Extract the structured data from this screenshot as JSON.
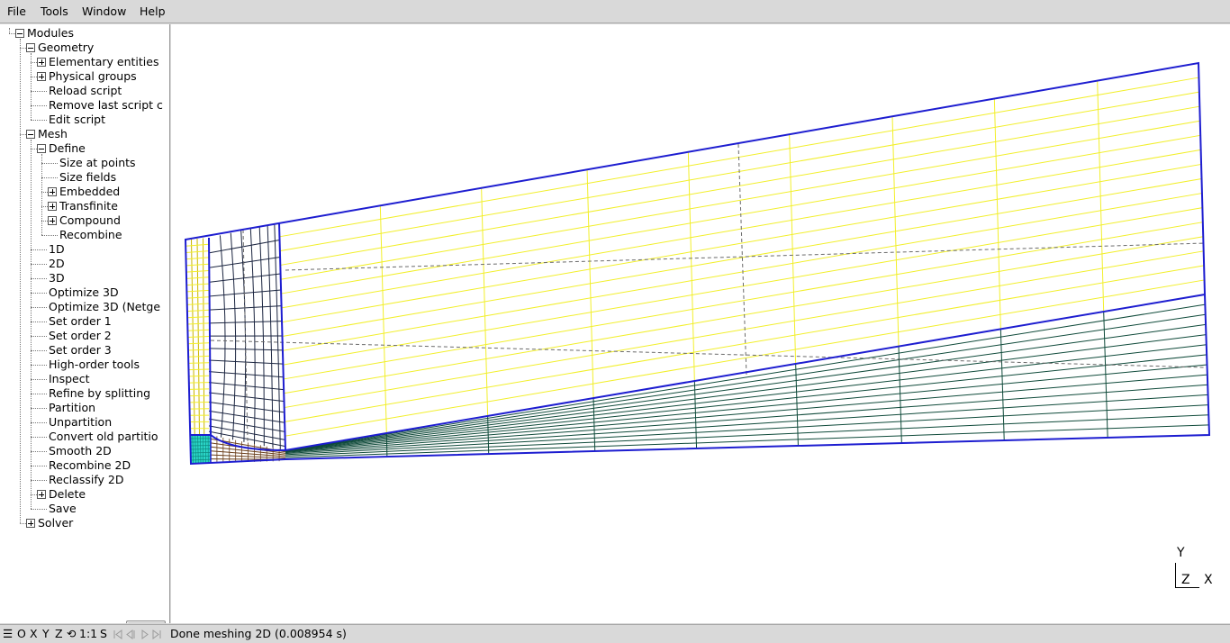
{
  "menu": {
    "file": "File",
    "tools": "Tools",
    "window": "Window",
    "help": "Help"
  },
  "tree": [
    {
      "label": "Modules",
      "toggle": "minus"
    },
    {
      "label": "Geometry",
      "toggle": "minus"
    },
    {
      "label": "Elementary entities",
      "toggle": "plus"
    },
    {
      "label": "Physical groups",
      "toggle": "plus"
    },
    {
      "label": "Reload script",
      "toggle": "none"
    },
    {
      "label": "Remove last script c",
      "toggle": "none"
    },
    {
      "label": "Edit script",
      "toggle": "none"
    },
    {
      "label": "Mesh",
      "toggle": "minus"
    },
    {
      "label": "Define",
      "toggle": "minus"
    },
    {
      "label": "Size at points",
      "toggle": "none"
    },
    {
      "label": "Size fields",
      "toggle": "none"
    },
    {
      "label": "Embedded",
      "toggle": "plus"
    },
    {
      "label": "Transfinite",
      "toggle": "plus"
    },
    {
      "label": "Compound",
      "toggle": "plus"
    },
    {
      "label": "Recombine",
      "toggle": "none"
    },
    {
      "label": "1D",
      "toggle": "none"
    },
    {
      "label": "2D",
      "toggle": "none"
    },
    {
      "label": "3D",
      "toggle": "none"
    },
    {
      "label": "Optimize 3D",
      "toggle": "none"
    },
    {
      "label": "Optimize 3D (Netge",
      "toggle": "none"
    },
    {
      "label": "Set order 1",
      "toggle": "none"
    },
    {
      "label": "Set order 2",
      "toggle": "none"
    },
    {
      "label": "Set order 3",
      "toggle": "none"
    },
    {
      "label": "High-order tools",
      "toggle": "none"
    },
    {
      "label": "Inspect",
      "toggle": "none"
    },
    {
      "label": "Refine by splitting",
      "toggle": "none"
    },
    {
      "label": "Partition",
      "toggle": "none"
    },
    {
      "label": "Unpartition",
      "toggle": "none"
    },
    {
      "label": "Convert old partitio",
      "toggle": "none"
    },
    {
      "label": "Smooth 2D",
      "toggle": "none"
    },
    {
      "label": "Recombine 2D",
      "toggle": "none"
    },
    {
      "label": "Reclassify 2D",
      "toggle": "none"
    },
    {
      "label": "Delete",
      "toggle": "plus"
    },
    {
      "label": "Save",
      "toggle": "none"
    },
    {
      "label": "Solver",
      "toggle": "plus"
    }
  ],
  "axes": {
    "y": "Y",
    "z": "Z",
    "x": "X"
  },
  "statusbar": {
    "hamburger": "☰",
    "o": "O",
    "x": "X",
    "y": "Y",
    "z": "Z",
    "rotate": "⟲",
    "scale": "1:1",
    "s": "S",
    "message": "Done meshing 2D (0.008954 s)"
  },
  "colors": {
    "boundary": "#1d1dd0",
    "mesh_yellow": "#f2ef2a",
    "mesh_green": "#0f4a3a",
    "mesh_dark": "#1b2540",
    "corner_cyan": "#2ad6c8",
    "corner_brown": "#6a3e1a"
  }
}
